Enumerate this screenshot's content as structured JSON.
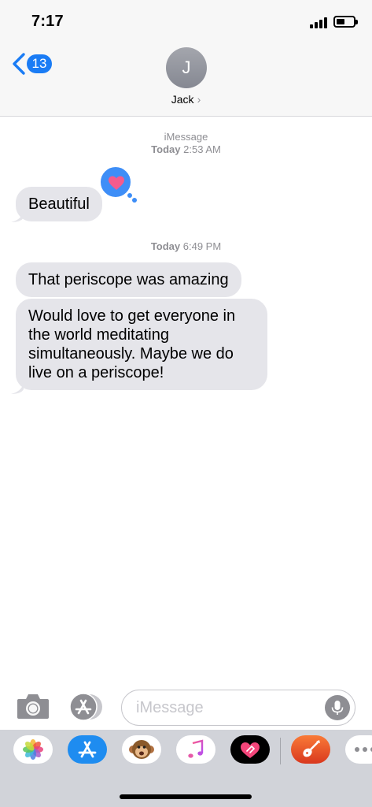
{
  "status_bar": {
    "time": "7:17"
  },
  "nav": {
    "back_count": "13",
    "avatar_initial": "J",
    "contact_name": "Jack",
    "name_chevron": "›"
  },
  "conversation": {
    "service_label": "iMessage",
    "meta1_day": "Today",
    "meta1_time": "2:53 AM",
    "meta2_day": "Today",
    "meta2_time": "6:49 PM",
    "messages": [
      {
        "text": "Beautiful",
        "tapback": "heart"
      },
      {
        "text": "That periscope was amazing"
      },
      {
        "text": "Would love to get everyone in the world meditating simultaneously. Maybe we do live on a periscope!"
      }
    ]
  },
  "composer": {
    "placeholder": "iMessage"
  },
  "app_drawer": {
    "apps": [
      "photos-icon",
      "app-store-icon",
      "animoji-icon",
      "music-icon",
      "digital-touch-icon",
      "garageband-icon",
      "more-icon"
    ]
  },
  "colors": {
    "accent": "#1a7cf5",
    "bubble_gray": "#e5e5ea",
    "meta_gray": "#8e8e93",
    "tapback_blue": "#3e8ef7",
    "heart_pink": "#f45b8d"
  }
}
